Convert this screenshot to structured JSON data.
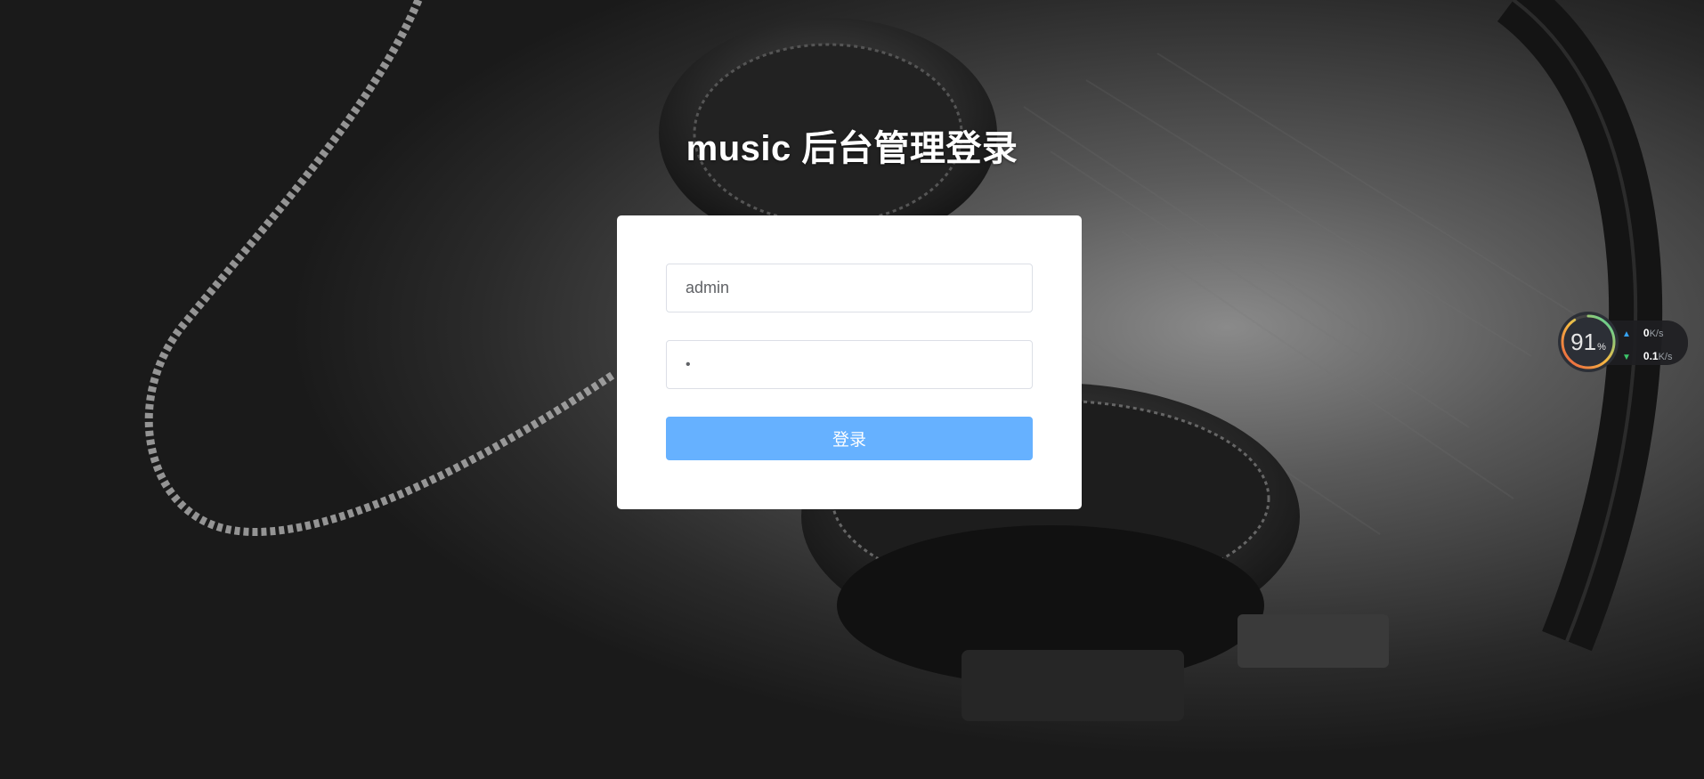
{
  "page": {
    "title": "music 后台管理登录"
  },
  "login_form": {
    "username_value": "admin",
    "password_value": "•",
    "submit_label": "登录"
  },
  "net_widget": {
    "usage_percent": "91",
    "usage_unit": "%",
    "upload_value": "0",
    "upload_unit": "K/s",
    "download_value": "0.1",
    "download_unit": "K/s"
  },
  "colors": {
    "button": "#66b1ff",
    "card": "#ffffff",
    "upload_arrow": "#36a3f7",
    "download_arrow": "#3cc66a"
  },
  "icons": {
    "upload": "arrow-up-icon",
    "download": "arrow-down-icon"
  }
}
